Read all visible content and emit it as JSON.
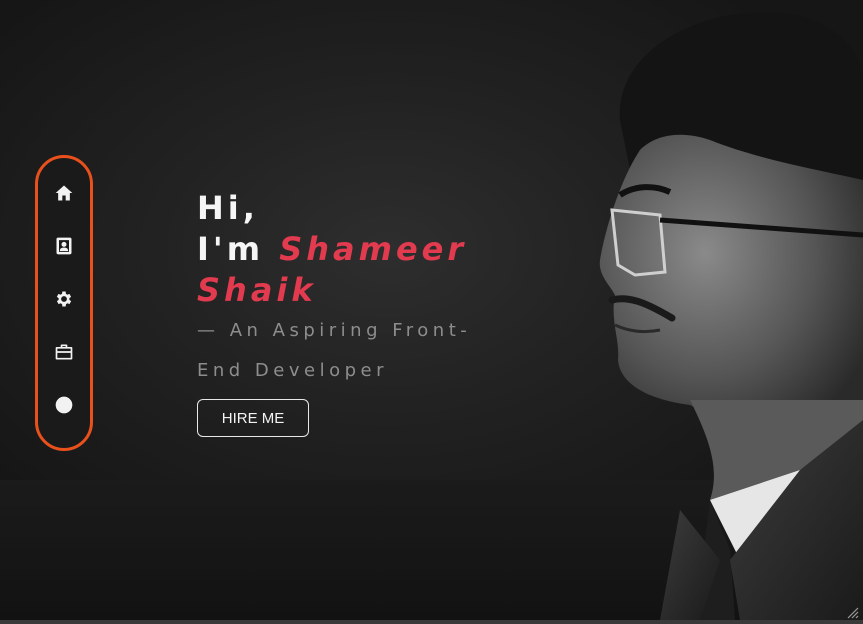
{
  "nav": {
    "items": [
      {
        "icon": "home-icon",
        "label": "Home"
      },
      {
        "icon": "contact-card-icon",
        "label": "About"
      },
      {
        "icon": "gear-icon",
        "label": "Skills"
      },
      {
        "icon": "briefcase-icon",
        "label": "Work"
      },
      {
        "icon": "globe-icon",
        "label": "Contact"
      }
    ]
  },
  "hero": {
    "greeting_line1": "Hi,",
    "greeting_prefix": "I'm ",
    "name_first": "Shameer",
    "name_last": "Shaik",
    "tagline": "— An Aspiring Front-End Developer",
    "cta_label": "HIRE ME"
  },
  "colors": {
    "accent": "#e23a4e",
    "nav_border": "#e8501c",
    "background": "#1c1c1c"
  }
}
